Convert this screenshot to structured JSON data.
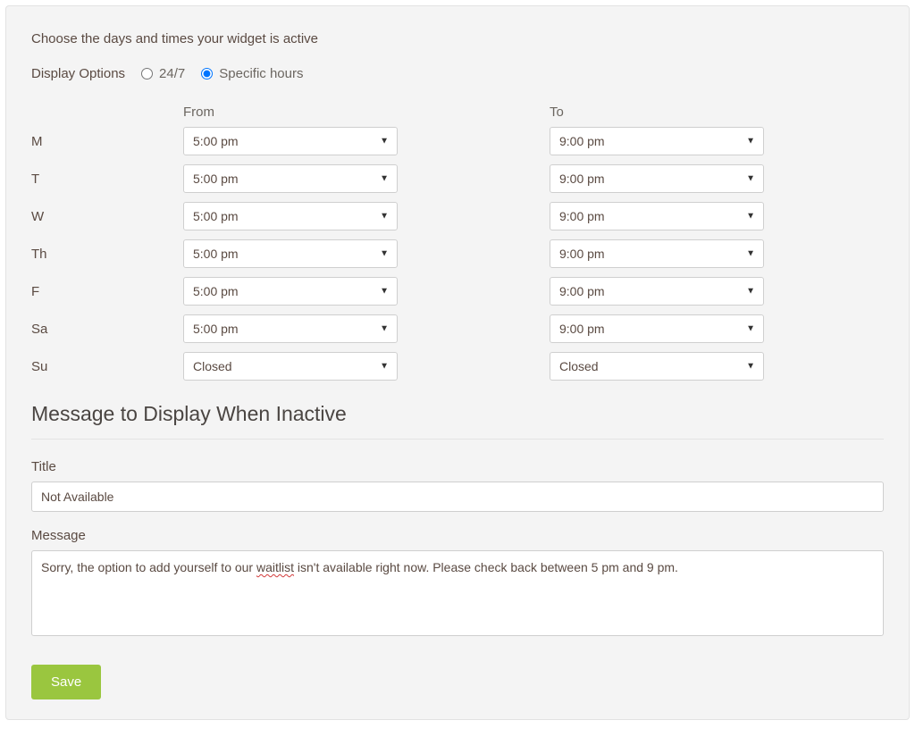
{
  "intro": "Choose the days and times your widget is active",
  "displayOptions": {
    "label": "Display Options",
    "option247": "24/7",
    "optionSpecific": "Specific hours",
    "selected": "specific"
  },
  "schedule": {
    "headers": {
      "from": "From",
      "to": "To"
    },
    "rows": [
      {
        "day": "M",
        "from": "5:00 pm",
        "to": "9:00 pm"
      },
      {
        "day": "T",
        "from": "5:00 pm",
        "to": "9:00 pm"
      },
      {
        "day": "W",
        "from": "5:00 pm",
        "to": "9:00 pm"
      },
      {
        "day": "Th",
        "from": "5:00 pm",
        "to": "9:00 pm"
      },
      {
        "day": "F",
        "from": "5:00 pm",
        "to": "9:00 pm"
      },
      {
        "day": "Sa",
        "from": "5:00 pm",
        "to": "9:00 pm"
      },
      {
        "day": "Su",
        "from": "Closed",
        "to": "Closed"
      }
    ]
  },
  "inactiveSection": {
    "heading": "Message to Display When Inactive",
    "titleLabel": "Title",
    "titleValue": "Not Available",
    "messageLabel": "Message",
    "messageParts": {
      "before": "Sorry, the option to add yourself to our ",
      "misspelled": "waitlist",
      "after": " isn't available right now. Please check back between 5 pm and 9 pm."
    }
  },
  "actions": {
    "save": "Save"
  }
}
